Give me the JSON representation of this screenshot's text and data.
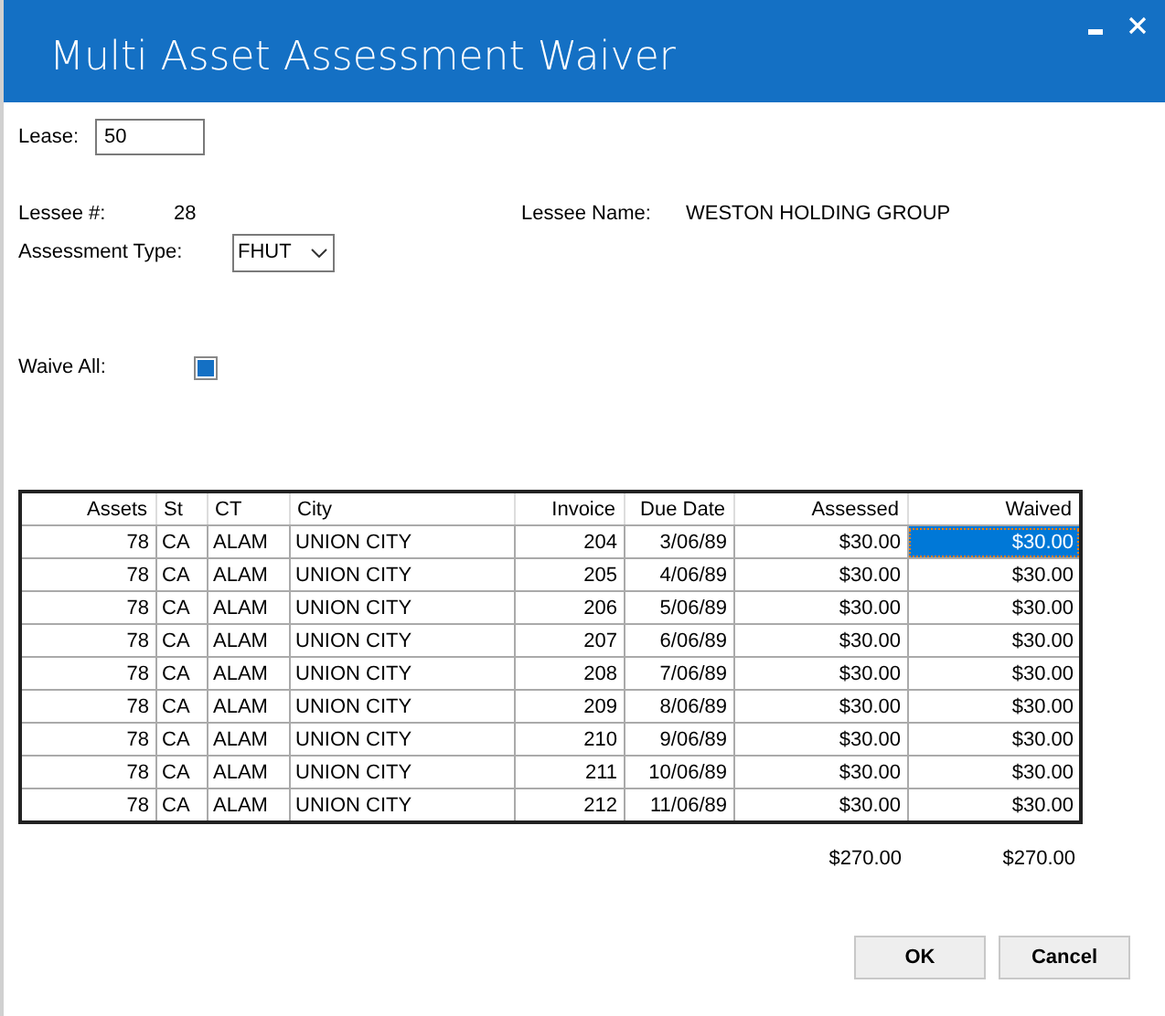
{
  "window": {
    "title": "Multi Asset Assessment Waiver"
  },
  "lease": {
    "label": "Lease:",
    "value": "50"
  },
  "lessee_number": {
    "label": "Lessee #:",
    "value": "28"
  },
  "lessee_name": {
    "label": "Lessee Name:",
    "value": "WESTON HOLDING GROUP"
  },
  "assessment_type": {
    "label": "Assessment Type:",
    "value": "FHUT"
  },
  "waive_all": {
    "label": "Waive All:",
    "checked": true
  },
  "table": {
    "columns": [
      "Assets",
      "St",
      "CT",
      "City",
      "Invoice",
      "Due Date",
      "Assessed",
      "Waived"
    ],
    "rows": [
      {
        "cells": [
          "78",
          "CA",
          "ALAM",
          "UNION CITY",
          "204",
          "3/06/89",
          "$30.00",
          "$30.00"
        ],
        "selected": true
      },
      {
        "cells": [
          "78",
          "CA",
          "ALAM",
          "UNION CITY",
          "205",
          "4/06/89",
          "$30.00",
          "$30.00"
        ],
        "selected": false
      },
      {
        "cells": [
          "78",
          "CA",
          "ALAM",
          "UNION CITY",
          "206",
          "5/06/89",
          "$30.00",
          "$30.00"
        ],
        "selected": false
      },
      {
        "cells": [
          "78",
          "CA",
          "ALAM",
          "UNION CITY",
          "207",
          "6/06/89",
          "$30.00",
          "$30.00"
        ],
        "selected": false
      },
      {
        "cells": [
          "78",
          "CA",
          "ALAM",
          "UNION CITY",
          "208",
          "7/06/89",
          "$30.00",
          "$30.00"
        ],
        "selected": false
      },
      {
        "cells": [
          "78",
          "CA",
          "ALAM",
          "UNION CITY",
          "209",
          "8/06/89",
          "$30.00",
          "$30.00"
        ],
        "selected": false
      },
      {
        "cells": [
          "78",
          "CA",
          "ALAM",
          "UNION CITY",
          "210",
          "9/06/89",
          "$30.00",
          "$30.00"
        ],
        "selected": false
      },
      {
        "cells": [
          "78",
          "CA",
          "ALAM",
          "UNION CITY",
          "211",
          "10/06/89",
          "$30.00",
          "$30.00"
        ],
        "selected": false
      },
      {
        "cells": [
          "78",
          "CA",
          "ALAM",
          "UNION CITY",
          "212",
          "11/06/89",
          "$30.00",
          "$30.00"
        ],
        "selected": false
      }
    ]
  },
  "totals": {
    "assessed": "$270.00",
    "waived": "$270.00"
  },
  "buttons": [
    "OK",
    "Cancel"
  ]
}
